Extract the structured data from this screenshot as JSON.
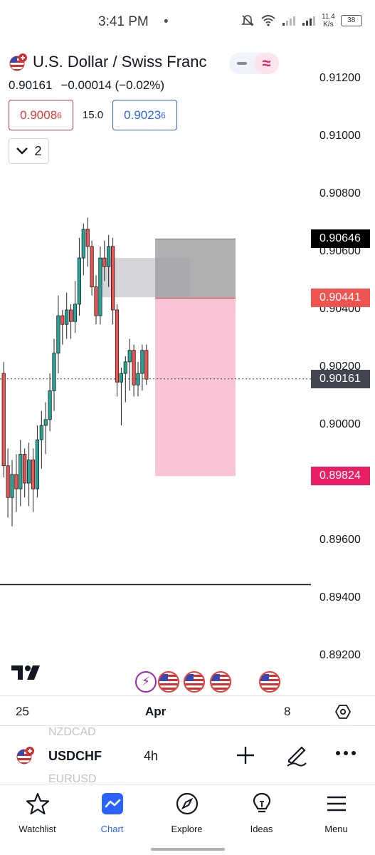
{
  "status_bar": {
    "time": "3:41 PM",
    "dot": "•",
    "speed_value": "11.4",
    "speed_unit": "K/s",
    "battery": "38"
  },
  "header": {
    "title": "U.S. Dollar / Swiss Franc",
    "last_price": "0.90161",
    "change": "−0.00014 (−0.02%)",
    "sell_price_main": "0.9008",
    "sell_price_sup": "6",
    "spread": "15.0",
    "buy_price_main": "0.9023",
    "buy_price_sup": "6",
    "expand_count": "2"
  },
  "price_axis": {
    "labels": [
      "0.91200",
      "0.91000",
      "0.90800",
      "0.90600",
      "0.90400",
      "0.90200",
      "0.90000",
      "0.89800",
      "0.89600",
      "0.89400",
      "0.89200"
    ],
    "tags": {
      "take_profit": "0.90646",
      "entry": "0.90441",
      "current": "0.90161",
      "stop": "0.89824"
    }
  },
  "time_axis": {
    "labels": [
      "25",
      "Apr",
      "8"
    ]
  },
  "symbol_bar": {
    "ghost_above": "NZDCAD",
    "symbol": "USDCHF",
    "timeframe": "4h",
    "ghost_below": "EURUSD"
  },
  "bottom_nav": {
    "items": [
      {
        "label": "Watchlist",
        "icon": "star-icon"
      },
      {
        "label": "Chart",
        "icon": "chart-icon"
      },
      {
        "label": "Explore",
        "icon": "compass-icon"
      },
      {
        "label": "Ideas",
        "icon": "lightbulb-icon"
      },
      {
        "label": "Menu",
        "icon": "hamburger-icon"
      }
    ]
  },
  "colors": {
    "up": "#26a69a",
    "down": "#ef5350",
    "brand": "#2962ff",
    "stop_zone": "#f8bbd0",
    "profit_zone": "#9e9e9e"
  },
  "chart_data": {
    "type": "candlestick",
    "symbol": "USDCHF",
    "timeframe": "4h",
    "ylim": [
      0.891,
      0.9131
    ],
    "candles": [
      {
        "o": 0.9018,
        "h": 0.9022,
        "l": 0.8982,
        "c": 0.8986
      },
      {
        "o": 0.8986,
        "h": 0.8992,
        "l": 0.8968,
        "c": 0.8975
      },
      {
        "o": 0.8975,
        "h": 0.8988,
        "l": 0.8965,
        "c": 0.8983
      },
      {
        "o": 0.8983,
        "h": 0.899,
        "l": 0.897,
        "c": 0.8978
      },
      {
        "o": 0.8978,
        "h": 0.8995,
        "l": 0.8972,
        "c": 0.899
      },
      {
        "o": 0.899,
        "h": 0.8992,
        "l": 0.8975,
        "c": 0.898
      },
      {
        "o": 0.898,
        "h": 0.8994,
        "l": 0.8972,
        "c": 0.8988
      },
      {
        "o": 0.8988,
        "h": 0.8992,
        "l": 0.897,
        "c": 0.8978
      },
      {
        "o": 0.8978,
        "h": 0.9,
        "l": 0.8975,
        "c": 0.8995
      },
      {
        "o": 0.8995,
        "h": 0.9005,
        "l": 0.8985,
        "c": 0.9
      },
      {
        "o": 0.9,
        "h": 0.9008,
        "l": 0.899,
        "c": 0.9002
      },
      {
        "o": 0.9002,
        "h": 0.9018,
        "l": 0.8998,
        "c": 0.9012
      },
      {
        "o": 0.9012,
        "h": 0.903,
        "l": 0.9005,
        "c": 0.9025
      },
      {
        "o": 0.9025,
        "h": 0.9045,
        "l": 0.9018,
        "c": 0.9038
      },
      {
        "o": 0.9038,
        "h": 0.904,
        "l": 0.9028,
        "c": 0.9035
      },
      {
        "o": 0.9035,
        "h": 0.9046,
        "l": 0.903,
        "c": 0.904
      },
      {
        "o": 0.904,
        "h": 0.9042,
        "l": 0.903,
        "c": 0.9036
      },
      {
        "o": 0.9036,
        "h": 0.905,
        "l": 0.9032,
        "c": 0.9042
      },
      {
        "o": 0.9042,
        "h": 0.9065,
        "l": 0.9038,
        "c": 0.9058
      },
      {
        "o": 0.9058,
        "h": 0.907,
        "l": 0.9052,
        "c": 0.9068
      },
      {
        "o": 0.9068,
        "h": 0.9072,
        "l": 0.9055,
        "c": 0.9062
      },
      {
        "o": 0.9062,
        "h": 0.9064,
        "l": 0.9045,
        "c": 0.9048
      },
      {
        "o": 0.9048,
        "h": 0.9052,
        "l": 0.9035,
        "c": 0.9038
      },
      {
        "o": 0.9038,
        "h": 0.9062,
        "l": 0.9035,
        "c": 0.9058
      },
      {
        "o": 0.9058,
        "h": 0.9064,
        "l": 0.905,
        "c": 0.9055
      },
      {
        "o": 0.9055,
        "h": 0.9066,
        "l": 0.9048,
        "c": 0.9062
      },
      {
        "o": 0.9062,
        "h": 0.9065,
        "l": 0.9035,
        "c": 0.904
      },
      {
        "o": 0.904,
        "h": 0.9042,
        "l": 0.901,
        "c": 0.9015
      },
      {
        "o": 0.9015,
        "h": 0.902,
        "l": 0.9,
        "c": 0.9018
      },
      {
        "o": 0.9018,
        "h": 0.9024,
        "l": 0.9008,
        "c": 0.9022
      },
      {
        "o": 0.9022,
        "h": 0.903,
        "l": 0.9012,
        "c": 0.9026
      },
      {
        "o": 0.9026,
        "h": 0.9028,
        "l": 0.901,
        "c": 0.9014
      },
      {
        "o": 0.9014,
        "h": 0.9022,
        "l": 0.901,
        "c": 0.9018
      },
      {
        "o": 0.9018,
        "h": 0.9028,
        "l": 0.9012,
        "c": 0.9026
      },
      {
        "o": 0.9026,
        "h": 0.9028,
        "l": 0.9014,
        "c": 0.9016
      }
    ],
    "position": {
      "entry": 0.90441,
      "target": 0.90646,
      "stop": 0.89824
    },
    "current_price": 0.90161
  }
}
